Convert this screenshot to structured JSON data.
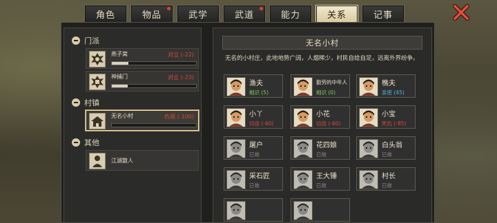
{
  "tabs": [
    {
      "label": "角色",
      "alert": false,
      "active": false
    },
    {
      "label": "物品",
      "alert": true,
      "active": false
    },
    {
      "label": "武学",
      "alert": false,
      "active": false
    },
    {
      "label": "武道",
      "alert": true,
      "active": false
    },
    {
      "label": "能力",
      "alert": false,
      "active": false
    },
    {
      "label": "关系",
      "alert": false,
      "active": true
    },
    {
      "label": "记事",
      "alert": false,
      "active": false
    }
  ],
  "close_icon": "close-x-icon",
  "groups": {
    "sect": {
      "label": "门派",
      "items": [
        {
          "name": "燕子窝",
          "relation": "对立 (-22)",
          "bar": 0.2,
          "icon": "sect-emblem-icon"
        },
        {
          "name": "神捕门",
          "relation": "对立 (-23)",
          "bar": 0.19,
          "icon": "sect-emblem-icon"
        }
      ]
    },
    "village": {
      "label": "村镇",
      "items": [
        {
          "name": "无名小村",
          "relation": "仇视 (-100)",
          "bar": 0.0,
          "icon": "village-house-icon",
          "selected": true
        }
      ]
    },
    "other": {
      "label": "其他",
      "items": [
        {
          "name": "江湖散人",
          "icon": "wanderer-icon"
        }
      ]
    }
  },
  "detail": {
    "title": "无名小村",
    "description": "无名的小村庄，此地地势广阔，人烟稀少，村民自给自足，远离外界纷争。",
    "npcs": [
      {
        "name": "渔夫",
        "status": "相识 (5)",
        "status_color": "#7fcf5a",
        "alive": true
      },
      {
        "name": "勤劳的中年人",
        "status": "相识 (0)",
        "status_color": "#7fcf5a",
        "alive": true
      },
      {
        "name": "樵夫",
        "status": "亲密 (45)",
        "status_color": "#4fb7e0",
        "alive": true
      },
      {
        "name": "小丫",
        "status": "切齿 (-60)",
        "status_color": "#d94a3a",
        "alive": true
      },
      {
        "name": "小花",
        "status": "切齿 (-60)",
        "status_color": "#d94a3a",
        "alive": true
      },
      {
        "name": "小宝",
        "status": "死仇 (-85)",
        "status_color": "#d94a3a",
        "alive": true
      },
      {
        "name": "屠户",
        "status": "已故",
        "status_color": "#8a877e",
        "alive": false
      },
      {
        "name": "花四娘",
        "status": "已故",
        "status_color": "#8a877e",
        "alive": false
      },
      {
        "name": "白头翁",
        "status": "已故",
        "status_color": "#8a877e",
        "alive": false
      },
      {
        "name": "采石匠",
        "status": "已故",
        "status_color": "#8a877e",
        "alive": false
      },
      {
        "name": "王大锤",
        "status": "已故",
        "status_color": "#8a877e",
        "alive": false
      },
      {
        "name": "村长",
        "status": "已故",
        "status_color": "#8a877e",
        "alive": false
      },
      {
        "name": "",
        "status": "",
        "status_color": "#8a877e",
        "alive": false
      },
      {
        "name": "",
        "status": "",
        "status_color": "#8a877e",
        "alive": false
      }
    ]
  }
}
